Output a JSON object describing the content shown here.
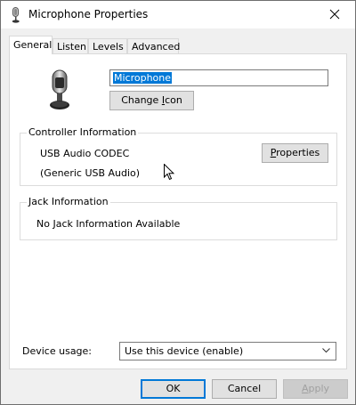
{
  "window": {
    "title": "Microphone Properties"
  },
  "tabs": [
    {
      "label": "General",
      "active": true
    },
    {
      "label": "Listen",
      "active": false
    },
    {
      "label": "Levels",
      "active": false
    },
    {
      "label": "Advanced",
      "active": false
    }
  ],
  "general": {
    "device_name": "Microphone",
    "change_icon_label_pre": "Change ",
    "change_icon_label_ul": "I",
    "change_icon_label_post": "con"
  },
  "controller": {
    "legend": "Controller Information",
    "line1": "USB Audio CODEC",
    "line2": "(Generic USB Audio)",
    "properties_label_ul": "P",
    "properties_label_post": "roperties"
  },
  "jack": {
    "legend": "Jack Information",
    "text": "No Jack Information Available"
  },
  "device_usage": {
    "label": "Device usage:",
    "selected": "Use this device (enable)"
  },
  "footer": {
    "ok_label": "OK",
    "cancel_label": "Cancel",
    "apply_label_ul": "A",
    "apply_label_post": "pply"
  },
  "icons": {
    "title": "microphone-icon",
    "device": "microphone-icon",
    "close": "close-icon",
    "dropdown": "chevron-down-icon",
    "cursor": "mouse-pointer-icon"
  }
}
